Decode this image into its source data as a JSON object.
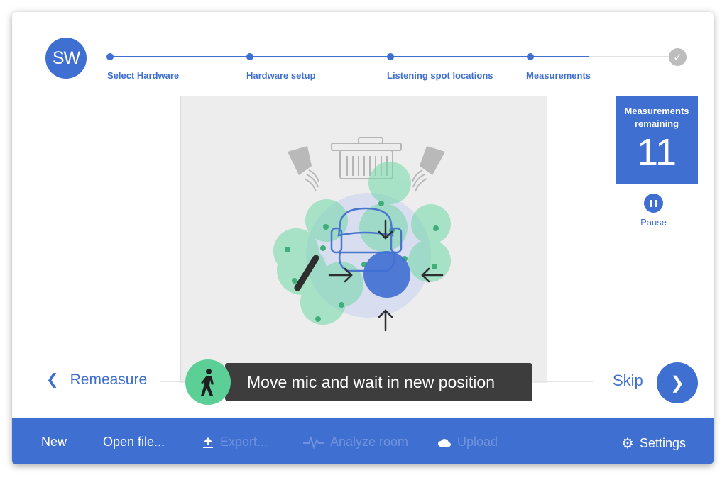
{
  "logo": {
    "text": "SW"
  },
  "steps": [
    {
      "label": "Select Hardware"
    },
    {
      "label": "Hardware setup"
    },
    {
      "label": "Listening spot locations"
    },
    {
      "label": "Measurements"
    }
  ],
  "measurements": {
    "label": "Measurements remaining",
    "count": "11"
  },
  "pause": {
    "label": "Pause"
  },
  "nav": {
    "remeasure_icon": "chevron-left-icon",
    "remeasure_label": "Remeasure",
    "skip_label": "Skip",
    "next_icon": "chevron-right-icon"
  },
  "toast": {
    "icon": "walking-person-icon",
    "message": "Move mic and wait in new position"
  },
  "toolbar": {
    "new": "New",
    "open_file": "Open file...",
    "export": "Export...",
    "analyze_room": "Analyze room",
    "upload": "Upload",
    "settings": "Settings"
  },
  "colors": {
    "accent": "#3f6fd1",
    "green": "#5ccf96",
    "disabled": "#6f93dc"
  }
}
